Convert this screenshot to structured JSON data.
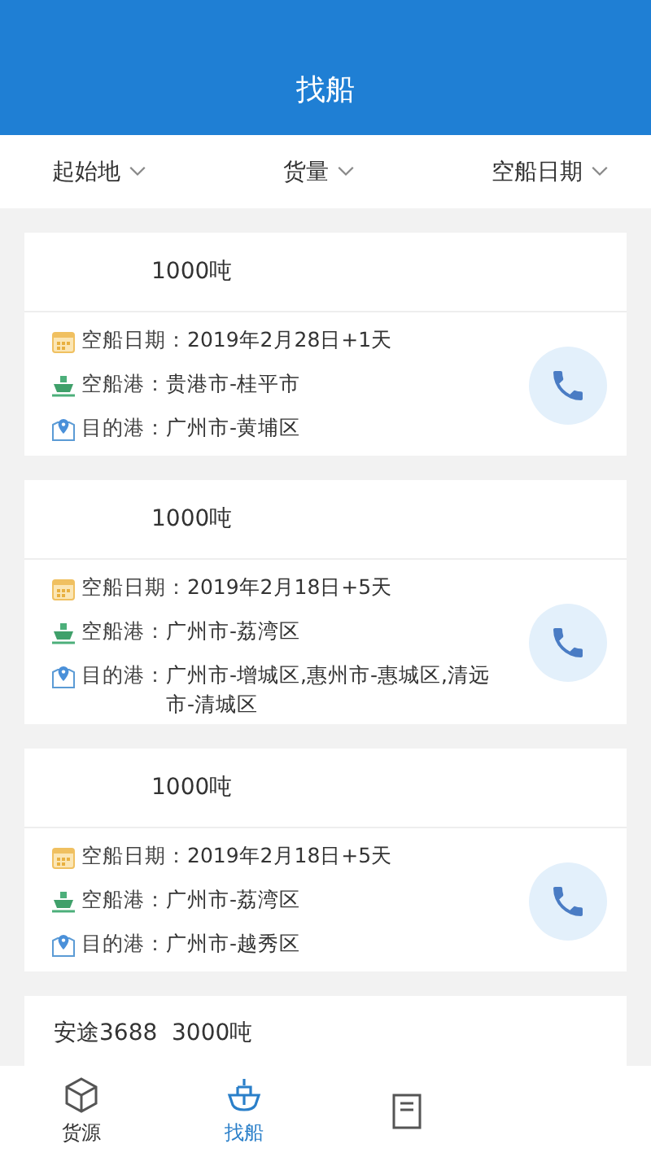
{
  "header": {
    "title": "找船"
  },
  "filters": [
    {
      "label": "起始地"
    },
    {
      "label": "货量"
    },
    {
      "label": "空船日期"
    }
  ],
  "ships": [
    {
      "title": "1000吨",
      "rows": [
        {
          "kind": "date",
          "label": "空船日期：",
          "value": "2019年2月28日+1天"
        },
        {
          "kind": "origin",
          "label": "空船港：",
          "value": "贵港市-桂平市"
        },
        {
          "kind": "destination",
          "label": "目的港：",
          "value": "广州市-黄埔区"
        }
      ]
    },
    {
      "title": "1000吨",
      "rows": [
        {
          "kind": "date",
          "label": "空船日期：",
          "value": "2019年2月18日+5天"
        },
        {
          "kind": "origin",
          "label": "空船港：",
          "value": "广州市-荔湾区"
        },
        {
          "kind": "destination",
          "label": "目的港：",
          "value": "广州市-增城区,惠州市-惠城区,清远市-清城区"
        }
      ]
    },
    {
      "title": "1000吨",
      "rows": [
        {
          "kind": "date",
          "label": "空船日期：",
          "value": "2019年2月18日+5天"
        },
        {
          "kind": "origin",
          "label": "空船港：",
          "value": "广州市-荔湾区"
        },
        {
          "kind": "destination",
          "label": "目的港：",
          "value": "广州市-越秀区"
        }
      ]
    },
    {
      "title": "安途3688  3000吨"
    }
  ],
  "nav": [
    {
      "kind": "cargo",
      "label": "货源",
      "selected": false
    },
    {
      "kind": "ship",
      "label": "找船",
      "selected": true
    },
    {
      "kind": "doc",
      "selected": false
    }
  ]
}
